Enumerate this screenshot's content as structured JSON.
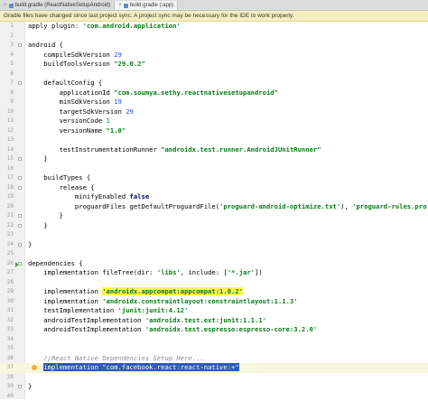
{
  "tabs": [
    {
      "label": "build.gradle (ReactNativeSetupAndroid)",
      "active": false
    },
    {
      "label": "build.gradle (:app)",
      "active": true
    }
  ],
  "banner": {
    "text": "Gradle files have changed since last project sync. A project sync may be necessary for the IDE to work properly."
  },
  "lines": [
    {
      "n": "1",
      "segs": [
        [
          "apply ",
          ""
        ],
        [
          "plugin",
          ""
        ],
        [
          ": ",
          ""
        ],
        [
          "'com.android.application'",
          "str"
        ]
      ]
    },
    {
      "n": "2",
      "segs": []
    },
    {
      "n": "3",
      "segs": [
        [
          "android {",
          ""
        ]
      ],
      "fold": true
    },
    {
      "n": "4",
      "segs": [
        [
          "    compileSdkVersion ",
          ""
        ],
        [
          "29",
          "num"
        ]
      ]
    },
    {
      "n": "5",
      "segs": [
        [
          "    buildToolsVersion ",
          ""
        ],
        [
          "\"29.0.2\"",
          "str"
        ]
      ]
    },
    {
      "n": "6",
      "segs": []
    },
    {
      "n": "7",
      "segs": [
        [
          "    defaultConfig {",
          ""
        ]
      ],
      "fold": true
    },
    {
      "n": "8",
      "segs": [
        [
          "        applicationId ",
          ""
        ],
        [
          "\"com.soumya.sethy.reactnativesetupandroid\"",
          "str"
        ]
      ]
    },
    {
      "n": "9",
      "segs": [
        [
          "        minSdkVersion ",
          ""
        ],
        [
          "19",
          "num"
        ]
      ]
    },
    {
      "n": "10",
      "segs": [
        [
          "        targetSdkVersion ",
          ""
        ],
        [
          "29",
          "num"
        ]
      ]
    },
    {
      "n": "11",
      "segs": [
        [
          "        versionCode ",
          ""
        ],
        [
          "1",
          "num"
        ]
      ]
    },
    {
      "n": "12",
      "segs": [
        [
          "        versionName ",
          ""
        ],
        [
          "\"1.0\"",
          "str"
        ]
      ]
    },
    {
      "n": "13",
      "segs": []
    },
    {
      "n": "14",
      "segs": [
        [
          "        testInstrumentationRunner ",
          ""
        ],
        [
          "\"androidx.test.runner.AndroidJUnitRunner\"",
          "str"
        ]
      ]
    },
    {
      "n": "15",
      "segs": [
        [
          "    }",
          ""
        ]
      ],
      "fold": true
    },
    {
      "n": "16",
      "segs": []
    },
    {
      "n": "17",
      "segs": [
        [
          "    buildTypes {",
          ""
        ]
      ],
      "fold": true
    },
    {
      "n": "18",
      "segs": [
        [
          "        release {",
          ""
        ]
      ],
      "fold": true
    },
    {
      "n": "19",
      "segs": [
        [
          "            minifyEnabled ",
          ""
        ],
        [
          "false",
          "kw"
        ]
      ]
    },
    {
      "n": "20",
      "segs": [
        [
          "            proguardFiles getDefaultProguardFile(",
          ""
        ],
        [
          "'proguard-android-optimize.txt'",
          "str"
        ],
        [
          "), ",
          ""
        ],
        [
          "'proguard-rules.pro'",
          "str"
        ]
      ]
    },
    {
      "n": "21",
      "segs": [
        [
          "        }",
          ""
        ]
      ],
      "fold": true
    },
    {
      "n": "22",
      "segs": [
        [
          "    }",
          ""
        ]
      ],
      "fold": true
    },
    {
      "n": "23",
      "segs": []
    },
    {
      "n": "24",
      "segs": [
        [
          "}",
          ""
        ]
      ],
      "fold": true
    },
    {
      "n": "25",
      "segs": []
    },
    {
      "n": "26",
      "segs": [
        [
          "dependencies {",
          ""
        ]
      ],
      "fold": true,
      "run": true
    },
    {
      "n": "27",
      "segs": [
        [
          "    implementation fileTree(",
          ""
        ],
        [
          "dir",
          ""
        ],
        [
          ": ",
          ""
        ],
        [
          "'libs'",
          "str"
        ],
        [
          ", ",
          ""
        ],
        [
          "include",
          ""
        ],
        [
          ": [",
          ""
        ],
        [
          "'*.jar'",
          "str"
        ],
        [
          "])",
          ""
        ]
      ]
    },
    {
      "n": "28",
      "segs": []
    },
    {
      "n": "29",
      "segs": [
        [
          "    implementation ",
          ""
        ],
        [
          "'androidx.appcompat:appcompat:1.0.2'",
          "str hl"
        ]
      ]
    },
    {
      "n": "30",
      "segs": [
        [
          "    implementation ",
          ""
        ],
        [
          "'androidx.constraintlayout:constraintlayout:1.1.3'",
          "str"
        ]
      ]
    },
    {
      "n": "31",
      "segs": [
        [
          "    testImplementation ",
          ""
        ],
        [
          "'junit:junit:4.12'",
          "str"
        ]
      ]
    },
    {
      "n": "32",
      "segs": [
        [
          "    androidTestImplementation ",
          ""
        ],
        [
          "'androidx.test.ext:junit:1.1.1'",
          "str"
        ]
      ]
    },
    {
      "n": "33",
      "segs": [
        [
          "    androidTestImplementation ",
          ""
        ],
        [
          "'androidx.test.espresso:espresso-core:3.2.0'",
          "str"
        ]
      ]
    },
    {
      "n": "34",
      "segs": []
    },
    {
      "n": "35",
      "segs": []
    },
    {
      "n": "36",
      "segs": [
        [
          "    ",
          ""
        ],
        [
          "//React Native Dependencies Setup Here...",
          "cm"
        ]
      ]
    },
    {
      "n": "37",
      "segs": [
        [
          "    ",
          ""
        ],
        [
          "implementation ",
          "sel"
        ],
        [
          "\"com.facebook.react:react-native:+\"",
          "sel"
        ]
      ],
      "selected": true,
      "bulb": true
    },
    {
      "n": "38",
      "segs": []
    },
    {
      "n": "39",
      "segs": [
        [
          "}",
          ""
        ]
      ],
      "fold": true
    },
    {
      "n": "40",
      "segs": []
    }
  ]
}
